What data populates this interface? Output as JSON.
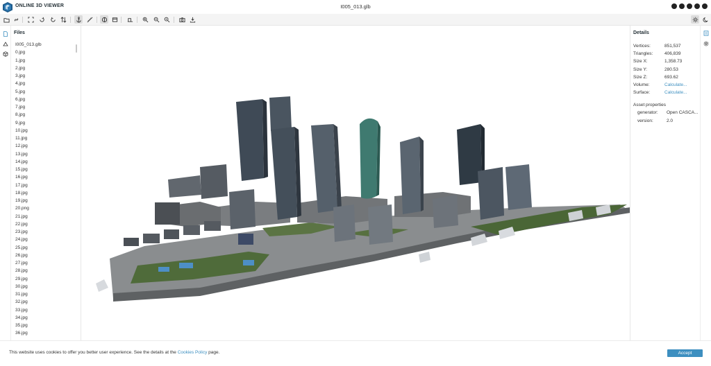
{
  "header": {
    "app_title": "ONLINE 3D VIEWER",
    "file_title": "I005_013.glb",
    "social_icons": [
      "info-icon",
      "heart-icon",
      "discussion-icon",
      "facebook-icon",
      "github-icon"
    ]
  },
  "toolbar": {
    "buttons": [
      {
        "name": "open-file-button",
        "icon": "open-icon"
      },
      {
        "name": "open-url-button",
        "icon": "link-icon"
      },
      {
        "name": "fit-to-window-button",
        "icon": "fit-icon"
      },
      {
        "name": "set-up-vector-button",
        "icon": "rotate-icon"
      },
      {
        "name": "flip-up-vector-button",
        "icon": "flip-icon"
      },
      {
        "name": "fix-up-vector-button",
        "icon": "axis-icon"
      },
      {
        "name": "free-orbit-button",
        "icon": "anchor-icon",
        "selected": true
      },
      {
        "name": "measure-button",
        "icon": "measure-icon"
      },
      {
        "name": "perspective-camera-button",
        "icon": "perspective-icon",
        "selected": true
      },
      {
        "name": "orthographic-camera-button",
        "icon": "orthographic-icon"
      },
      {
        "name": "edges-button",
        "icon": "edges-icon"
      },
      {
        "name": "zoom-in-button",
        "icon": "zoom-in-icon"
      },
      {
        "name": "zoom-out-button",
        "icon": "zoom-out-icon"
      },
      {
        "name": "zoom-fit-button",
        "icon": "zoom-fit-icon"
      },
      {
        "name": "snapshot-button",
        "icon": "camera-icon"
      },
      {
        "name": "export-button",
        "icon": "export-icon"
      },
      {
        "name": "theme-light-button",
        "icon": "sun-icon",
        "selected": true
      },
      {
        "name": "theme-dark-button",
        "icon": "moon-icon"
      }
    ]
  },
  "files_panel": {
    "title": "Files",
    "items": [
      "I005_013.glb",
      "0.jpg",
      "1.jpg",
      "2.jpg",
      "3.jpg",
      "4.jpg",
      "5.jpg",
      "6.jpg",
      "7.jpg",
      "8.jpg",
      "9.jpg",
      "10.jpg",
      "11.jpg",
      "12.jpg",
      "13.jpg",
      "14.jpg",
      "15.jpg",
      "16.jpg",
      "17.jpg",
      "18.jpg",
      "19.jpg",
      "20.png",
      "21.jpg",
      "22.jpg",
      "23.jpg",
      "24.jpg",
      "25.jpg",
      "26.jpg",
      "27.jpg",
      "28.jpg",
      "29.jpg",
      "30.jpg",
      "31.jpg",
      "32.jpg",
      "33.jpg",
      "34.jpg",
      "35.jpg",
      "36.jpg"
    ]
  },
  "details_panel": {
    "title": "Details",
    "rows": [
      {
        "label": "Vertices:",
        "value": "851,537"
      },
      {
        "label": "Triangles:",
        "value": "406,839"
      },
      {
        "label": "Size X:",
        "value": "1,358.73"
      },
      {
        "label": "Size Y:",
        "value": "280.53"
      },
      {
        "label": "Size Z:",
        "value": "693.62"
      },
      {
        "label": "Volume:",
        "value": "Calculate..."
      },
      {
        "label": "Surface:",
        "value": "Calculate..."
      }
    ],
    "asset_properties_title": "Asset properties",
    "asset_properties": [
      {
        "label": "generator:",
        "value": "Open CASCA..."
      },
      {
        "label": "version:",
        "value": "2.0"
      }
    ]
  },
  "cookie_bar": {
    "text_before": "This website uses cookies to offer you better user experience. See the details at the ",
    "link": "Cookies Policy",
    "text_after": " page.",
    "accept_label": "Accept"
  },
  "colors": {
    "accent": "#3d8fc0",
    "toolbar_bg": "#f4f4f4",
    "text": "#263238"
  }
}
